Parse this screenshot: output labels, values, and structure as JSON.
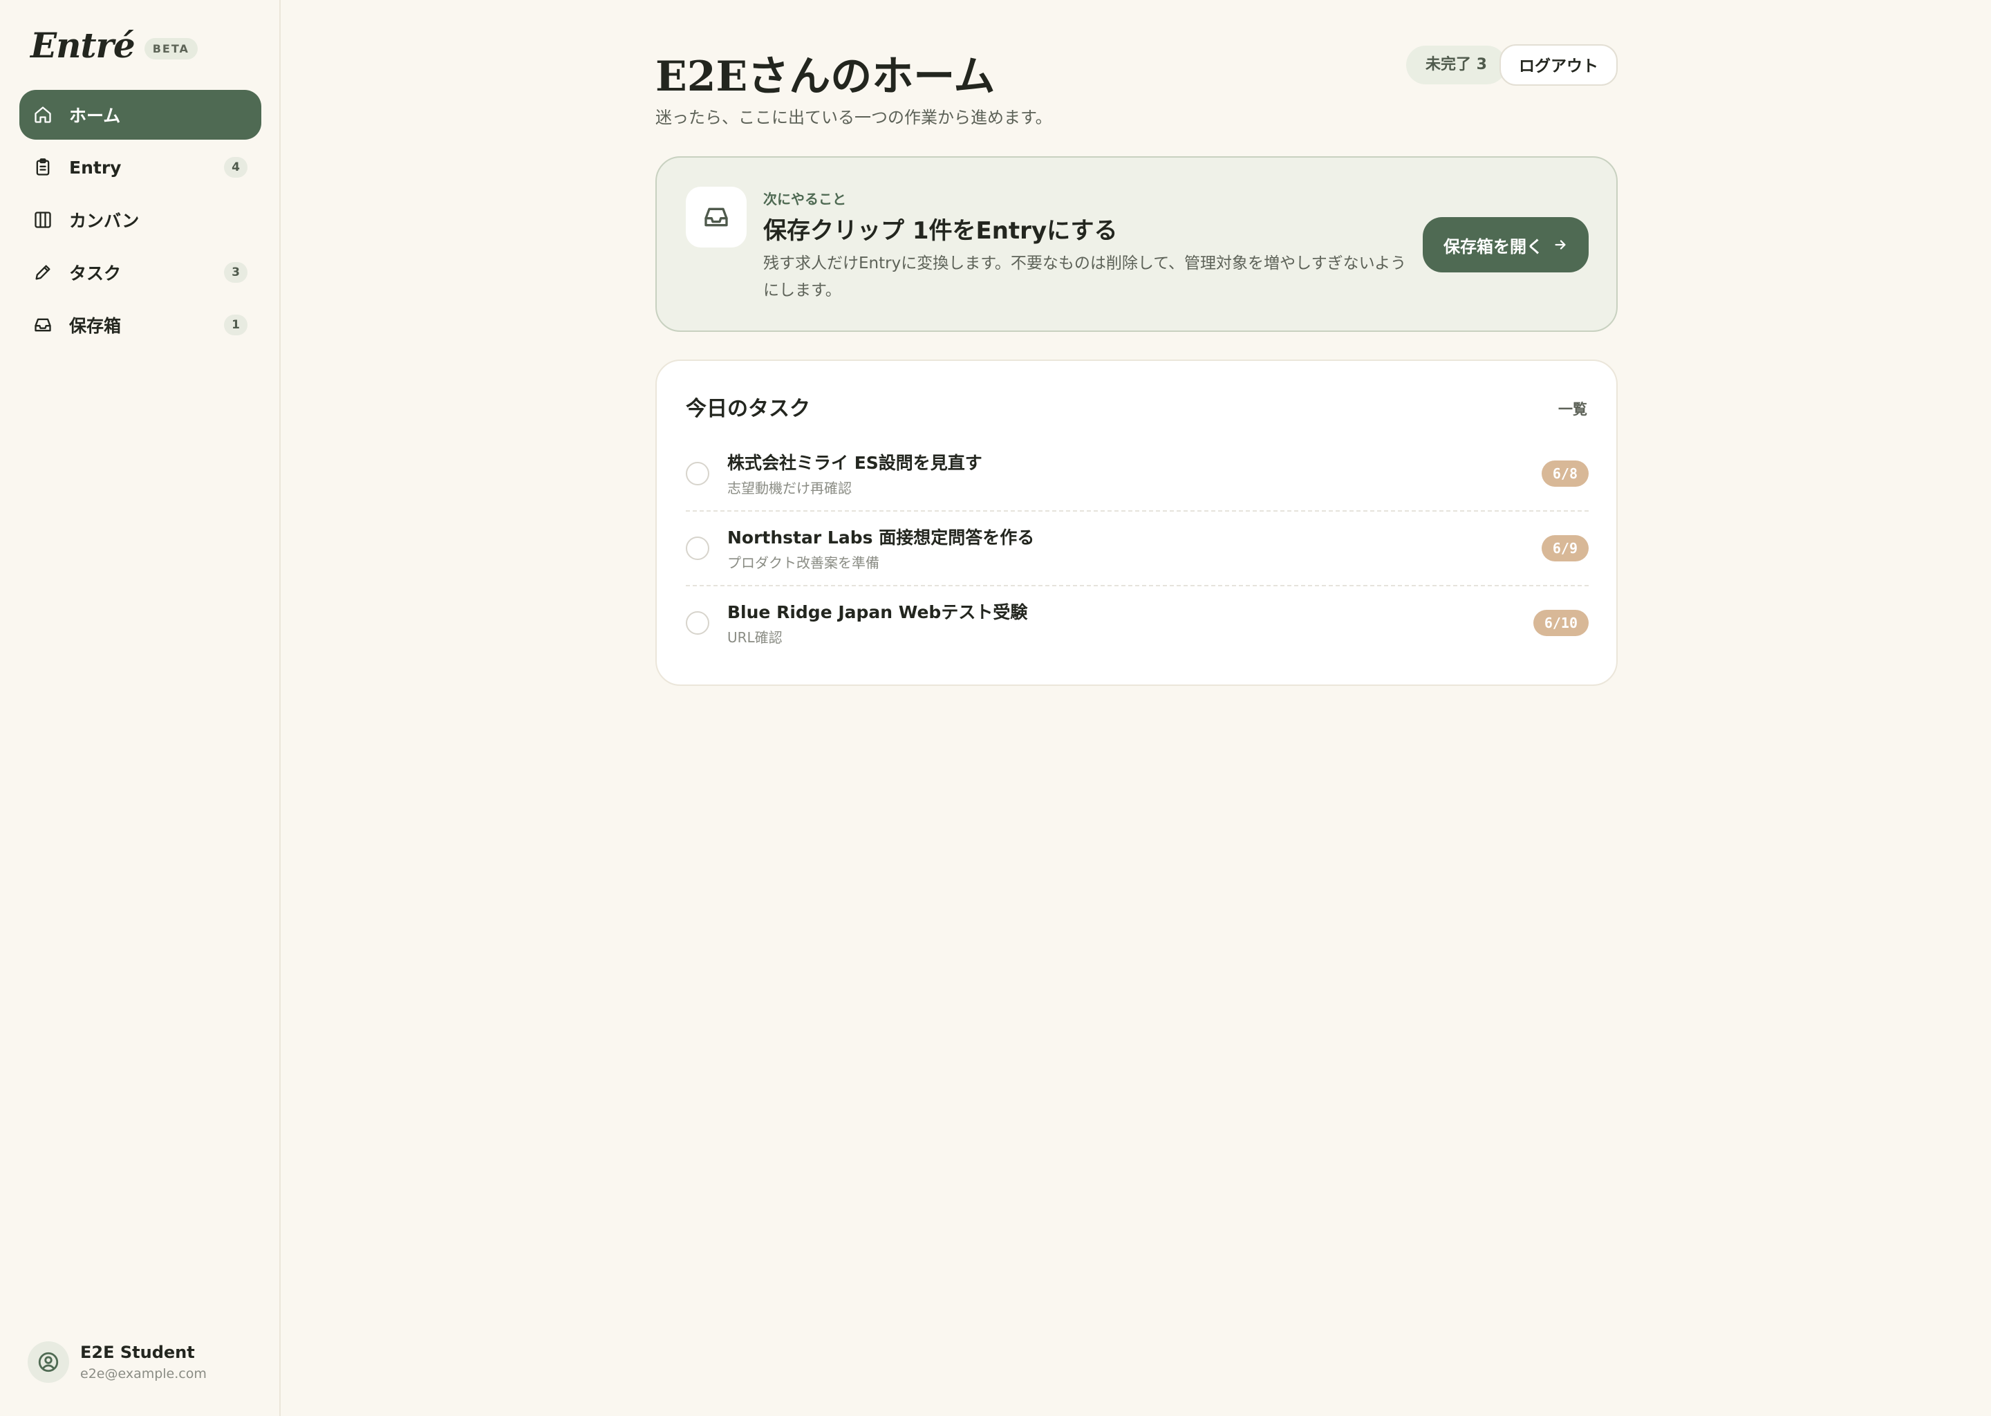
{
  "brand": {
    "name": "Entré",
    "badge": "BETA"
  },
  "sidebar": {
    "items": [
      {
        "label": "ホーム",
        "icon": "home-icon",
        "active": true
      },
      {
        "label": "Entry",
        "icon": "clipboard-icon",
        "count": "4"
      },
      {
        "label": "カンバン",
        "icon": "columns-icon"
      },
      {
        "label": "タスク",
        "icon": "pencil-icon",
        "count": "3"
      },
      {
        "label": "保存箱",
        "icon": "inbox-icon",
        "count": "1"
      }
    ]
  },
  "user": {
    "name": "E2E Student",
    "email": "e2e@example.com",
    "icon": "user-circle-icon"
  },
  "header": {
    "title": "E2Eさんのホーム",
    "subtitle": "迷ったら、ここに出ている一つの作業から進めます。",
    "pending_badge": "未完了 3",
    "logout_label": "ログアウト"
  },
  "next_action": {
    "eyebrow": "次にやること",
    "title": "保存クリップ 1件をEntryにする",
    "description": "残す求人だけEntryに変換します。不要なものは削除して、管理対象を増やしすぎないようにします。",
    "button_label": "保存箱を開く",
    "icon": "inbox-icon"
  },
  "tasks": {
    "title": "今日のタスク",
    "link_label": "一覧",
    "items": [
      {
        "title": "株式会社ミライ ES設問を見直す",
        "subtitle": "志望動機だけ再確認",
        "date": "6/8"
      },
      {
        "title": "Northstar Labs 面接想定問答を作る",
        "subtitle": "プロダクト改善案を準備",
        "date": "6/9"
      },
      {
        "title": "Blue Ridge Japan Webテスト受験",
        "subtitle": "URL確認",
        "date": "6/10"
      }
    ]
  },
  "colors": {
    "accent": "#4f6a53",
    "background": "#faf7f0",
    "date_badge": "#d8b897",
    "next_card_bg": "#eff1e8"
  }
}
